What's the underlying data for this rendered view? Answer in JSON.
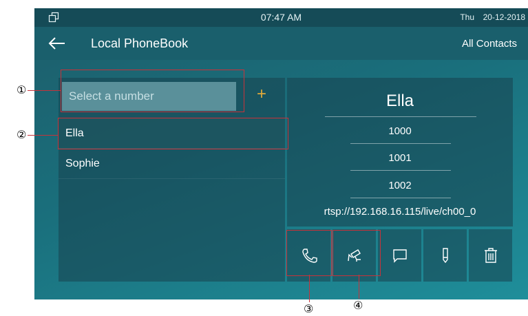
{
  "status_bar": {
    "time": "07:47 AM",
    "day": "Thu",
    "date": "20-12-2018"
  },
  "header": {
    "title": "Local PhoneBook",
    "filter_label": "All Contacts"
  },
  "search": {
    "placeholder": "Select a number",
    "add_label": "+"
  },
  "contacts": [
    {
      "name": "Ella"
    },
    {
      "name": "Sophie"
    }
  ],
  "detail": {
    "name": "Ella",
    "numbers": [
      "1000",
      "1001",
      "1002"
    ],
    "rtsp_url": "rtsp://192.168.16.115/live/ch00_0"
  },
  "actions": [
    {
      "icon": "phone-icon"
    },
    {
      "icon": "camera-icon"
    },
    {
      "icon": "message-icon"
    },
    {
      "icon": "edit-icon"
    },
    {
      "icon": "delete-icon"
    }
  ],
  "callouts": [
    "①",
    "②",
    "③",
    "④"
  ],
  "colors": {
    "accent_add": "#e0a93a",
    "callout_red": "#c8323a",
    "status_bar": "#154b57"
  }
}
